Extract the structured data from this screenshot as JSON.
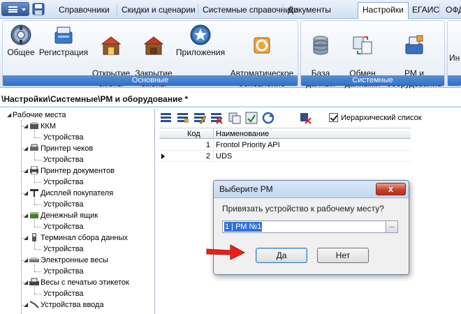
{
  "menubar": {
    "tabs": [
      {
        "label": "Справочники"
      },
      {
        "label": "Скидки и сценарии"
      },
      {
        "label": "Системные справочники"
      },
      {
        "label": "Документы"
      },
      {
        "label": "Настройки"
      },
      {
        "label": "ЕГАИС"
      },
      {
        "label": "ОФД"
      }
    ],
    "active_tab": "Настройки"
  },
  "ribbon": {
    "groups": [
      {
        "label": "Основные",
        "buttons": [
          {
            "label": "Общее",
            "icon": "gear-icon"
          },
          {
            "label": "Регистрация",
            "icon": "register-icon"
          },
          {
            "label": "Открытие\nсмены",
            "icon": "shop-open-icon"
          },
          {
            "label": "Закрытие\nсмены",
            "icon": "shop-close-icon"
          },
          {
            "label": "Приложения",
            "icon": "star-icon"
          },
          {
            "label": "Автоматическое\nобновление",
            "icon": "update-icon"
          }
        ]
      },
      {
        "label": "Системные",
        "buttons": [
          {
            "label": "База\nданных",
            "icon": "database-icon"
          },
          {
            "label": "Обмен\nданными",
            "icon": "exchange-icon"
          },
          {
            "label": "РМ и\nоборудование",
            "icon": "workstation-icon"
          }
        ]
      },
      {
        "label": "",
        "buttons": [
          {
            "label": "Ин",
            "icon": "info-icon"
          }
        ]
      }
    ]
  },
  "breadcrumb": "\\Настройки\\Системные\\РМ и оборудование *",
  "tree": {
    "root": "Рабочие места",
    "items": [
      {
        "label": "ККМ",
        "child": "Устройства"
      },
      {
        "label": "Принтер чеков",
        "child": "Устройства"
      },
      {
        "label": "Принтер документов",
        "child": "Устройства"
      },
      {
        "label": "Дисплей покупателя",
        "child": "Устройства"
      },
      {
        "label": "Денежный ящик",
        "child": "Устройства"
      },
      {
        "label": "Терминал сбора данных",
        "child": "Устройства"
      },
      {
        "label": "Электронные весы",
        "child": "Устройства"
      },
      {
        "label": "Весы с печатью этикеток",
        "child": "Устройства"
      },
      {
        "label": "Устройства ввода",
        "child": ""
      }
    ]
  },
  "toolbar": {
    "hierarchy_label": "Иерархический список",
    "hierarchy_checked": true
  },
  "grid": {
    "columns": [
      "Код",
      "Наименование"
    ],
    "rows": [
      {
        "code": "1",
        "name": "Frontol Priority API"
      },
      {
        "code": "2",
        "name": "UDS"
      }
    ]
  },
  "dialog": {
    "title": "Выберите РМ",
    "close_label": "x",
    "question": "Привязать устройство к рабочему месту?",
    "field_value": "1 | РМ №1",
    "browse_label": "...",
    "yes_label": "Да",
    "no_label": "Нет"
  }
}
